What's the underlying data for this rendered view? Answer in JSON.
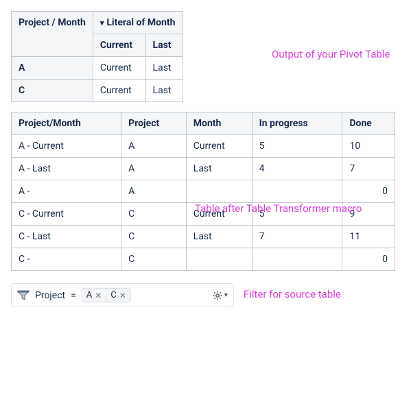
{
  "pivot": {
    "col_project_month": "Project / Month",
    "col_literal": "Literal of Month",
    "sub_current": "Current",
    "sub_last": "Last",
    "rows": [
      {
        "project": "A",
        "current": "Current",
        "last": "Last"
      },
      {
        "project": "C",
        "current": "Current",
        "last": "Last"
      }
    ]
  },
  "annotations": {
    "pivot": "Output of your Pivot Table",
    "transformer": "Table after Table Transformer macro",
    "filter": "Filter for source table"
  },
  "data_table": {
    "headers": {
      "pm": "Project/Month",
      "project": "Project",
      "month": "Month",
      "in_progress": "In progress",
      "done": "Done"
    },
    "rows": [
      {
        "pm": "A - Current",
        "project": "A",
        "month": "Current",
        "in_progress": "5",
        "done": "10",
        "done_align": "left"
      },
      {
        "pm": "A - Last",
        "project": "A",
        "month": "Last",
        "in_progress": "4",
        "done": "7",
        "done_align": "left"
      },
      {
        "pm": "A -",
        "project": "A",
        "month": "",
        "in_progress": "",
        "done": "0",
        "done_align": "right"
      },
      {
        "pm": "C - Current",
        "project": "C",
        "month": "Current",
        "in_progress": "5",
        "done": "9",
        "done_align": "left"
      },
      {
        "pm": "C - Last",
        "project": "C",
        "month": "Last",
        "in_progress": "7",
        "done": "11",
        "done_align": "left"
      },
      {
        "pm": "C -",
        "project": "C",
        "month": "",
        "in_progress": "",
        "done": "0",
        "done_align": "right"
      }
    ]
  },
  "filter": {
    "label": "Project",
    "eq": "=",
    "chips": [
      "A",
      "C"
    ],
    "chip_close": "✕"
  },
  "icons": {
    "filter": "filter-icon",
    "gear": "gear-icon",
    "chevron_down": "chevron-down-icon"
  }
}
